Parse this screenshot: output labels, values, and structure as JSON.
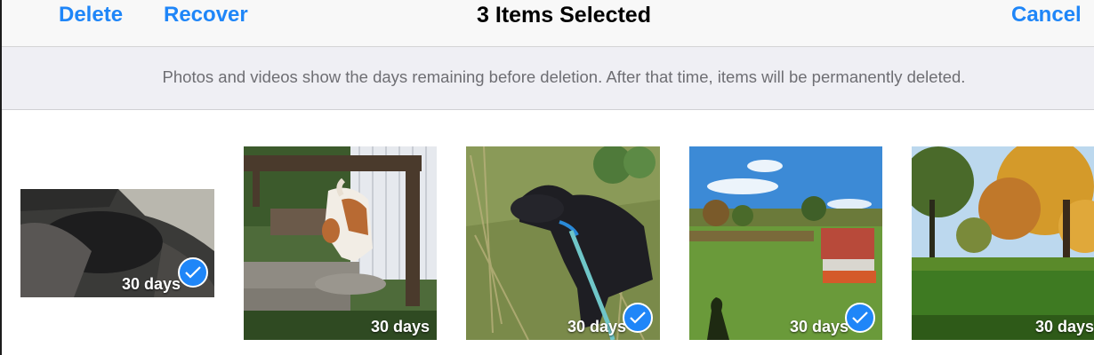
{
  "navbar": {
    "delete_label": "Delete",
    "recover_label": "Recover",
    "title": "3 Items Selected",
    "cancel_label": "Cancel"
  },
  "info": {
    "text": "Photos and videos show the days remaining before deletion. After that time, items will be permanently deleted."
  },
  "photos": [
    {
      "days": "30 days",
      "selected": true,
      "subject": "dark-blurry"
    },
    {
      "days": "30 days",
      "selected": false,
      "subject": "dog-on-steps"
    },
    {
      "days": "30 days",
      "selected": true,
      "subject": "black-dog-leash"
    },
    {
      "days": "30 days",
      "selected": true,
      "subject": "yard-sky"
    },
    {
      "days": "30 days",
      "selected": false,
      "subject": "autumn-trees"
    }
  ],
  "colors": {
    "accent": "#1f86f8",
    "nav_bg": "#f8f8f8",
    "info_bg": "#efeff4"
  }
}
